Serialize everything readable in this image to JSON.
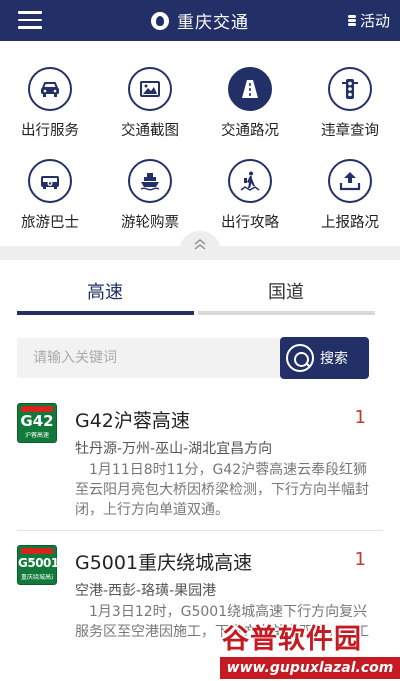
{
  "header": {
    "title": "重庆交通",
    "activity_label": "活动"
  },
  "grid": {
    "items": [
      {
        "label": "出行服务",
        "icon": "car-icon"
      },
      {
        "label": "交通截图",
        "icon": "image-icon"
      },
      {
        "label": "交通路况",
        "icon": "road-icon"
      },
      {
        "label": "违章查询",
        "icon": "traffic-light-icon"
      },
      {
        "label": "旅游巴士",
        "icon": "bus-icon"
      },
      {
        "label": "游轮购票",
        "icon": "cruise-ship-icon"
      },
      {
        "label": "出行攻略",
        "icon": "hiker-map-icon"
      },
      {
        "label": "上报路况",
        "icon": "upload-icon"
      }
    ]
  },
  "tabs": [
    {
      "label": "高速",
      "active": true
    },
    {
      "label": "国道",
      "active": false
    }
  ],
  "search": {
    "placeholder": "请输入关键词",
    "button_label": "搜索"
  },
  "roads": [
    {
      "sign_code": "G42",
      "sign_name": "沪蓉高速",
      "name": "G42沪蓉高速",
      "count": "1",
      "route": "牡丹源-万州-巫山-湖北宜昌方向",
      "description": "1月11日8时11分，G42沪蓉高速云奉段红狮至云阳月亮包大桥因桥梁检测，下行方向半幅封闭，上行方向单道双通。"
    },
    {
      "sign_code": "G5001",
      "sign_name": "重庆绕城高速",
      "name": "G5001重庆绕城高速",
      "count": "1",
      "route": "空港-西彭-珞璜-果园港",
      "description": "1月3日12时，G5001绕城高速下行方向复兴服务区至空港因施工，下行方向单道双通，施工"
    }
  ],
  "watermark": {
    "title": "谷普软件园",
    "url": "www.gupuxlazal.com"
  },
  "colors": {
    "brand": "#233068",
    "sign_green": "#117a3a",
    "count_red": "#c0392b",
    "watermark_red": "#c61a22"
  }
}
